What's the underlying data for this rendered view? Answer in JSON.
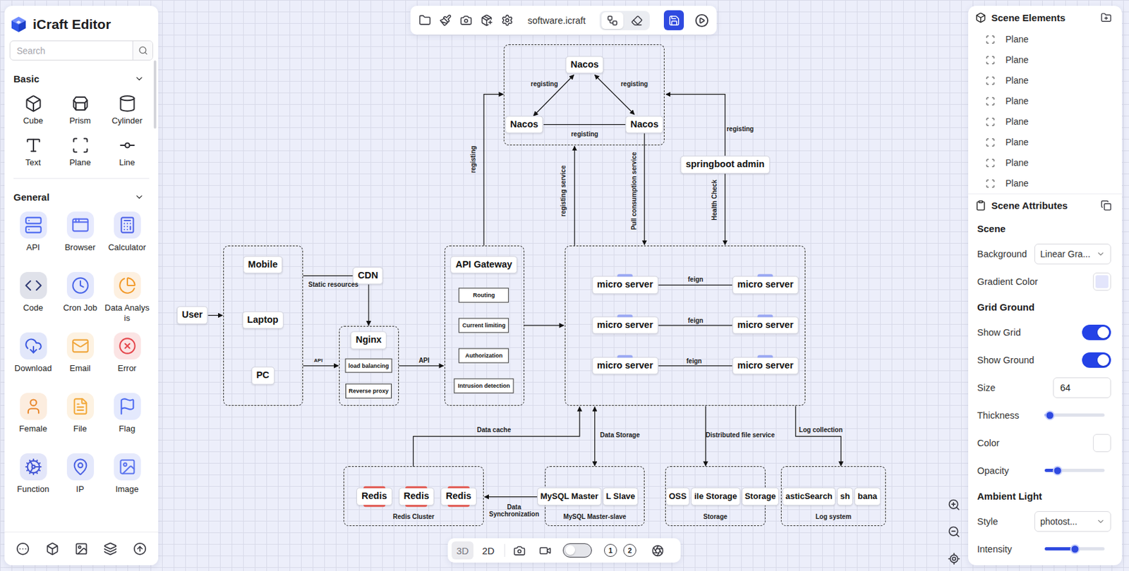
{
  "app": {
    "title": "iCraft Editor"
  },
  "search": {
    "placeholder": "Search"
  },
  "basic": {
    "title": "Basic",
    "expanded": true,
    "items": [
      "Cube",
      "Prism",
      "Cylinder",
      "Text",
      "Plane",
      "Line"
    ]
  },
  "general": {
    "title": "General",
    "expanded": true,
    "items": [
      {
        "label": "API",
        "color": "#4a68f0"
      },
      {
        "label": "Browser",
        "color": "#5b6ff0"
      },
      {
        "label": "Calculator",
        "color": "#4f63e8"
      },
      {
        "label": "Code",
        "color": "#2f3a73"
      },
      {
        "label": "Cron Job",
        "color": "#4a66e8"
      },
      {
        "label": "Data Analysis",
        "color": "#f29b2c"
      },
      {
        "label": "Download",
        "color": "#3e5be0"
      },
      {
        "label": "Email",
        "color": "#f0a63c"
      },
      {
        "label": "Error",
        "color": "#e5484d"
      },
      {
        "label": "Female",
        "color": "#e8862a"
      },
      {
        "label": "File",
        "color": "#f2a93b"
      },
      {
        "label": "Flag",
        "color": "#4b69f0"
      },
      {
        "label": "Function",
        "color": "#4659d6"
      },
      {
        "label": "IP",
        "color": "#4d63e3"
      },
      {
        "label": "Image",
        "color": "#5a73ee"
      }
    ]
  },
  "toolbar": {
    "file_name": "software.icraft",
    "view_switch": [
      {
        "selected": true
      },
      {
        "selected": false
      }
    ],
    "save_active": true
  },
  "scene_elements": {
    "title": "Scene Elements",
    "items": [
      "Plane",
      "Plane",
      "Plane",
      "Plane",
      "Plane",
      "Plane",
      "Plane",
      "Plane"
    ]
  },
  "scene_attributes": {
    "title": "Scene Attributes",
    "rows": [
      {
        "kind": "heading",
        "label": "Scene"
      },
      {
        "kind": "select",
        "label": "Background",
        "value": "Linear Gra..."
      },
      {
        "kind": "swatch",
        "label": "Gradient Color",
        "color": "#e3e5fb"
      },
      {
        "kind": "heading",
        "label": "Grid Ground"
      },
      {
        "kind": "toggle",
        "label": "Show Grid",
        "on": true
      },
      {
        "kind": "toggle",
        "label": "Show Ground",
        "on": true
      },
      {
        "kind": "number",
        "label": "Size",
        "value": "64"
      },
      {
        "kind": "slider",
        "label": "Thickness",
        "level": 0.09
      },
      {
        "kind": "swatch",
        "label": "Color",
        "color": "#ffffff"
      },
      {
        "kind": "slider",
        "label": "Opacity",
        "level": 0.22
      },
      {
        "kind": "heading",
        "label": "Ambient Light"
      },
      {
        "kind": "select",
        "label": "Style",
        "value": "photost..."
      },
      {
        "kind": "slider",
        "label": "Intensity",
        "level": 0.5
      }
    ]
  },
  "view_bar": {
    "modes": [
      {
        "label": "3D",
        "selected": true
      },
      {
        "label": "2D",
        "selected": false
      }
    ],
    "recording": false,
    "presets": [
      "1",
      "2"
    ]
  },
  "diagram": {
    "nodes": [
      {
        "label": "Nacos",
        "kind": "node"
      },
      {
        "label": "Nacos",
        "kind": "node"
      },
      {
        "label": "Nacos",
        "kind": "node"
      },
      {
        "label": "springboot admin",
        "kind": "node"
      },
      {
        "label": "User",
        "kind": "node"
      },
      {
        "label": "Mobile",
        "kind": "node"
      },
      {
        "label": "Laptop",
        "kind": "node"
      },
      {
        "label": "PC",
        "kind": "node"
      },
      {
        "label": "CDN",
        "kind": "node"
      },
      {
        "label": "Nginx",
        "kind": "node"
      },
      {
        "label": "load balancing",
        "kind": "sub"
      },
      {
        "label": "Reverse proxy",
        "kind": "sub"
      },
      {
        "label": "API Gateway",
        "kind": "node"
      },
      {
        "label": "Routing",
        "kind": "sub"
      },
      {
        "label": "Current limiting",
        "kind": "sub"
      },
      {
        "label": "Authorization",
        "kind": "sub"
      },
      {
        "label": "Intrusion detection",
        "kind": "sub"
      },
      {
        "label": "micro server",
        "kind": "micro"
      },
      {
        "label": "micro server",
        "kind": "micro"
      },
      {
        "label": "micro server",
        "kind": "micro"
      },
      {
        "label": "micro server",
        "kind": "micro"
      },
      {
        "label": "micro server",
        "kind": "micro"
      },
      {
        "label": "micro server",
        "kind": "micro"
      }
    ],
    "clusters": [
      {
        "label": "Redis Cluster",
        "nodes": [
          {
            "label": "Redis",
            "kind": "redis"
          },
          {
            "label": "Redis",
            "kind": "redis"
          },
          {
            "label": "Redis",
            "kind": "redis"
          }
        ]
      },
      {
        "label": "MySQL Master-slave",
        "nodes": [
          {
            "label": "MySQL Master",
            "kind": "tight"
          },
          {
            "label": "L Slave",
            "kind": "tight"
          }
        ]
      },
      {
        "label": "Storage",
        "nodes": [
          {
            "label": "OSS",
            "kind": "tight"
          },
          {
            "label": "ile Storage",
            "kind": "tight"
          },
          {
            "label": "Storage",
            "kind": "tight"
          }
        ]
      },
      {
        "label": "Log system",
        "nodes": [
          {
            "label": "asticSearch",
            "kind": "tight"
          },
          {
            "label": "sh",
            "kind": "tight"
          },
          {
            "label": "bana",
            "kind": "tight"
          }
        ]
      }
    ],
    "edge_labels": [
      "registing",
      "registing",
      "registing",
      "registing",
      "registing service",
      "Pull consumption service",
      "registing",
      "Health Check",
      "Static resources",
      "API",
      "API",
      "feign",
      "feign",
      "feign",
      "Data cache",
      "Data Storage",
      "Distributed file service",
      "Log collection",
      "Data\nSynchronization"
    ]
  }
}
